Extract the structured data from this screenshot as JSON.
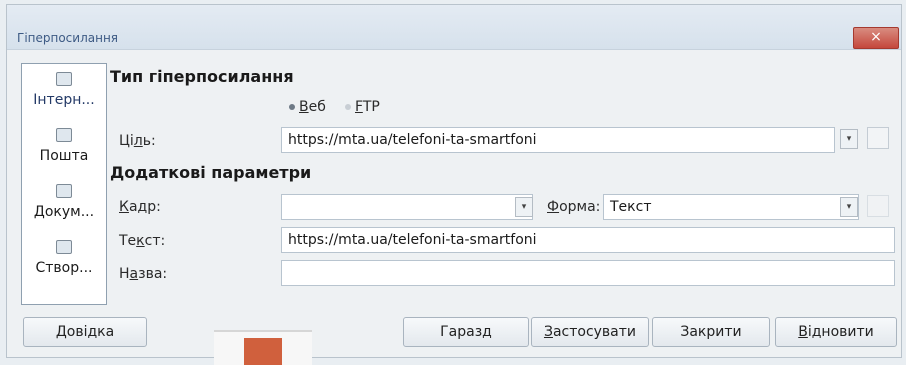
{
  "window": {
    "title": "Гіперпосилання",
    "close_icon": "×"
  },
  "sidebar": {
    "items": [
      {
        "label": "Інтерн...",
        "icon": "globe-icon"
      },
      {
        "label": "Пошта",
        "icon": "mail-icon"
      },
      {
        "label": "Докум...",
        "icon": "document-icon"
      },
      {
        "label": "Створ...",
        "icon": "new-document-icon"
      }
    ]
  },
  "hyperlink_type": {
    "heading": "Тип гіперпосилання",
    "options": [
      {
        "mnemonic": "В",
        "rest": "еб",
        "selected": true
      },
      {
        "mnemonic": "F",
        "rest": "TP",
        "selected": false
      }
    ],
    "target_label": {
      "pre": "Ці",
      "mnemonic": "л",
      "post": "ь:"
    },
    "target_value": "https://mta.ua/telefoni-ta-smartfoni",
    "dropdown_icon": "▾"
  },
  "additional": {
    "heading": "Додаткові параметри",
    "frame_label": {
      "mnemonic": "К",
      "post": "адр:"
    },
    "frame_value": "",
    "form_label": {
      "mnemonic": "Ф",
      "post": "орма:"
    },
    "form_value": "Текст",
    "text_label": {
      "pre": "Те",
      "mnemonic": "к",
      "post": "ст:"
    },
    "text_value": "https://mta.ua/telefoni-ta-smartfoni",
    "name_label": {
      "pre": "Н",
      "mnemonic": "а",
      "post": "зва:"
    },
    "name_value": ""
  },
  "buttons": {
    "help": {
      "pre": "",
      "mnemonic": "Д",
      "post": "овідка"
    },
    "ok": {
      "pre": "",
      "mnemonic": "",
      "post": "Гаразд"
    },
    "apply": {
      "pre": "",
      "mnemonic": "З",
      "post": "астосувати"
    },
    "close": {
      "pre": "",
      "mnemonic": "",
      "post": "Закрити"
    },
    "reset": {
      "pre": "",
      "mnemonic": "В",
      "post": "ідновити"
    }
  }
}
